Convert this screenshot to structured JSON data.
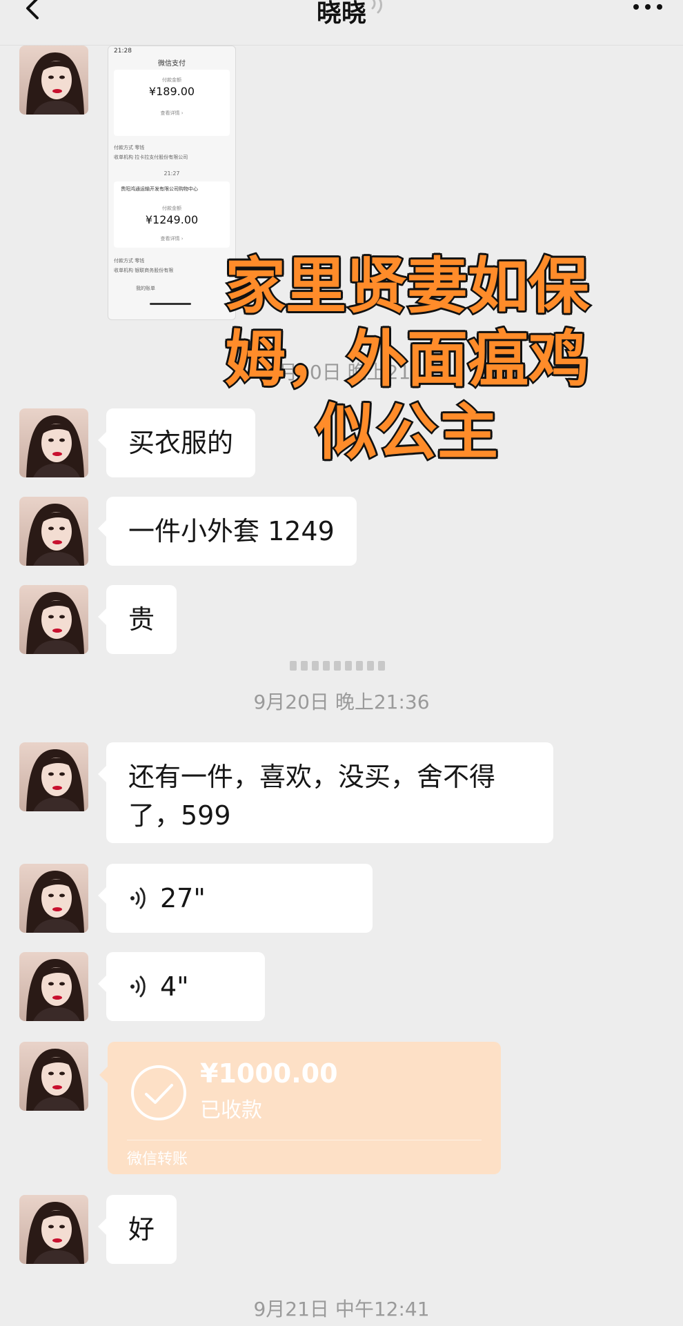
{
  "header": {
    "title": "晓晓",
    "back_icon": "chevron-left-icon",
    "mute_icon": "mute-icon",
    "more_icon": "more-dots-icon"
  },
  "screenshot_card": {
    "status_time": "21:28",
    "nav_title": "微信支付",
    "first_label": "付款金额",
    "first_amount": "¥189.00",
    "first_detail": "查看详情 ›",
    "row1": "付款方式    零钱",
    "row2": "收单机构    拉卡拉支付股份有限公司",
    "time2": "21:27",
    "merchant": "贵阳鸿通运输开发有限公司购物中心",
    "second_label": "付款金额",
    "second_amount": "¥1249.00",
    "second_detail": "查看详情 ›",
    "row3": "付款方式    零钱",
    "row4": "收单机构    银联商务股份有限",
    "bottom": "我的账单"
  },
  "timestamps": {
    "t1": "9月20日 晚上21:",
    "t2": "9月20日 晚上21:36",
    "t3": "9月21日 中午12:41"
  },
  "messages": {
    "m1": "买衣服的",
    "m2": "一件小外套 1249",
    "m3": "贵",
    "m4_line1": "还有一件，喜欢，没买，舍不得",
    "m4_line2": "了，599",
    "voice1": "27\"",
    "voice2": "4\"",
    "m5": "好"
  },
  "transfer": {
    "amount": "¥1000.00",
    "status": "已收款",
    "footer": "微信转账"
  },
  "overlay": {
    "line1": "家里贤妻如保",
    "line2": "姆，外面瘟鸡",
    "line3": "似公主"
  },
  "colors": {
    "background": "#ededed",
    "bubble": "#ffffff",
    "transfer": "#fde0c6",
    "overlay_fill": "#ff8c2a"
  }
}
